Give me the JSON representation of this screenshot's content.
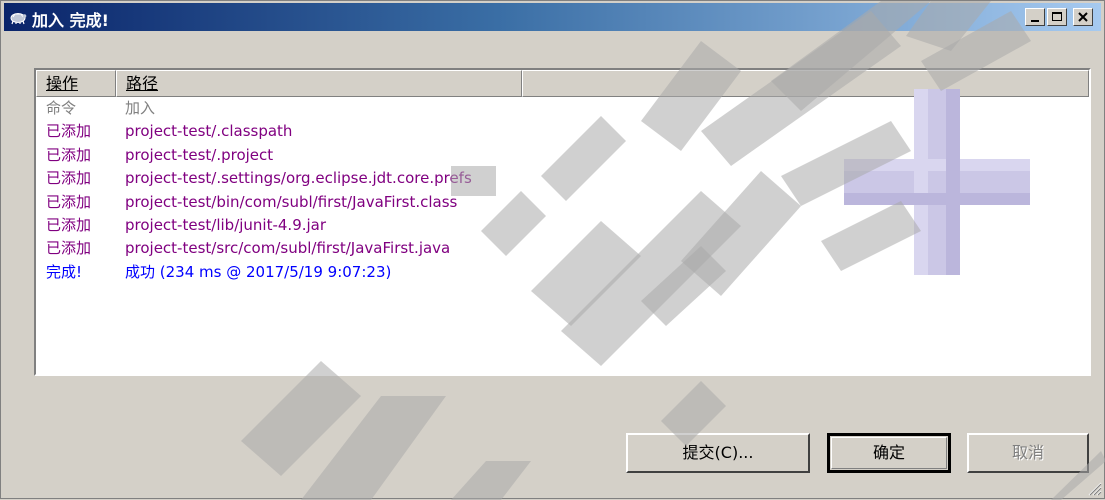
{
  "window": {
    "title": "加入 完成!",
    "minimize_label": "_",
    "maximize_label": "□",
    "close_label": "×"
  },
  "list": {
    "columns": [
      "操作",
      "路径",
      ""
    ],
    "rows": [
      {
        "op": "命令",
        "path": "加入",
        "kind": "cmd"
      },
      {
        "op": "已添加",
        "path": "project-test/.classpath",
        "kind": "add"
      },
      {
        "op": "已添加",
        "path": "project-test/.project",
        "kind": "add"
      },
      {
        "op": "已添加",
        "path": "project-test/.settings/org.eclipse.jdt.core.prefs",
        "kind": "add"
      },
      {
        "op": "已添加",
        "path": "project-test/bin/com/subl/first/JavaFirst.class",
        "kind": "add"
      },
      {
        "op": "已添加",
        "path": "project-test/lib/junit-4.9.jar",
        "kind": "add"
      },
      {
        "op": "已添加",
        "path": "project-test/src/com/subl/first/JavaFirst.java",
        "kind": "add"
      },
      {
        "op": "完成!",
        "path": "成功 (234 ms @ 2017/5/19 9:07:23)",
        "kind": "done"
      }
    ]
  },
  "buttons": {
    "commit": "提交(C)...",
    "ok": "确定",
    "cancel": "取消"
  },
  "colors": {
    "titlebar_start": "#0a246a",
    "titlebar_end": "#a6caf0",
    "added": "#800080",
    "command": "#808080",
    "done": "#0000ff",
    "plus_icon": "#c8c4e4"
  },
  "icons": {
    "title": "tortoise-icon",
    "status": "add-plus-icon"
  }
}
